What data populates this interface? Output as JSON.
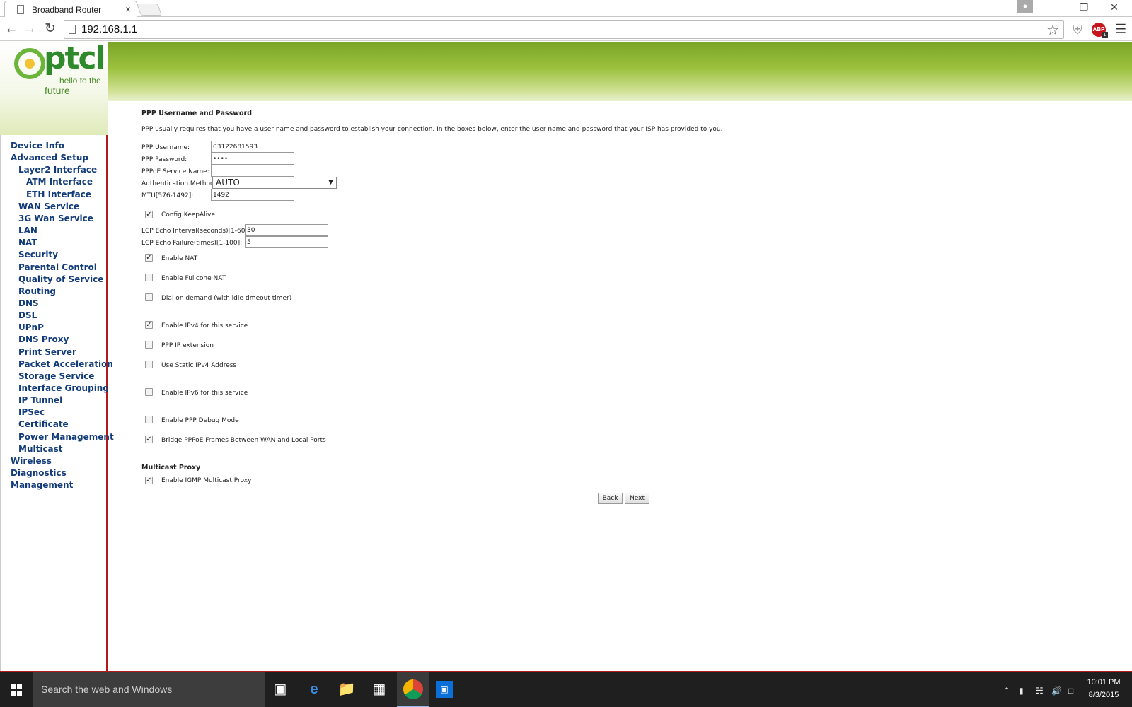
{
  "browser": {
    "tab_title": "Broadband Router",
    "tab_close": "×",
    "url": "192.168.1.1",
    "abp_label": "ABP",
    "abp_badge": "1"
  },
  "logo": {
    "brand": "ptcl",
    "tagline_1": "hello to the",
    "tagline_2": "future",
    "colors": {
      "ring": "#6bb53a",
      "dot": "#f1c232",
      "text": "#2f8a2b"
    }
  },
  "sidebar": {
    "items": [
      {
        "label": "Device Info",
        "level": 0
      },
      {
        "label": "Advanced Setup",
        "level": 0
      },
      {
        "label": "Layer2 Interface",
        "level": 1
      },
      {
        "label": "ATM Interface",
        "level": 2
      },
      {
        "label": "ETH Interface",
        "level": 2
      },
      {
        "label": "WAN Service",
        "level": 1
      },
      {
        "label": "3G Wan Service",
        "level": 1
      },
      {
        "label": "LAN",
        "level": 1
      },
      {
        "label": "NAT",
        "level": 1
      },
      {
        "label": "Security",
        "level": 1
      },
      {
        "label": "Parental Control",
        "level": 1
      },
      {
        "label": "Quality of Service",
        "level": 1
      },
      {
        "label": "Routing",
        "level": 1
      },
      {
        "label": "DNS",
        "level": 1
      },
      {
        "label": "DSL",
        "level": 1
      },
      {
        "label": "UPnP",
        "level": 1
      },
      {
        "label": "DNS Proxy",
        "level": 1
      },
      {
        "label": "Print Server",
        "level": 1
      },
      {
        "label": "Packet Acceleration",
        "level": 1
      },
      {
        "label": "Storage Service",
        "level": 1
      },
      {
        "label": "Interface Grouping",
        "level": 1
      },
      {
        "label": "IP Tunnel",
        "level": 1
      },
      {
        "label": "IPSec",
        "level": 1
      },
      {
        "label": "Certificate",
        "level": 1
      },
      {
        "label": "Power Management",
        "level": 1
      },
      {
        "label": "Multicast",
        "level": 1
      },
      {
        "label": "Wireless",
        "level": 0
      },
      {
        "label": "Diagnostics",
        "level": 0
      },
      {
        "label": "Management",
        "level": 0
      }
    ]
  },
  "form": {
    "heading": "PPP Username and Password",
    "intro": "PPP usually requires that you have a user name and password to establish your connection. In the boxes below, enter the user name and password that your ISP has provided to you.",
    "ppp_username_label": "PPP Username:",
    "ppp_username_value": "03122681593",
    "ppp_password_label": "PPP Password:",
    "ppp_password_value": "••••",
    "pppoe_service_label": "PPPoE Service Name:",
    "pppoe_service_value": "",
    "auth_method_label": "Authentication Method:",
    "auth_method_value": "AUTO",
    "mtu_label": "MTU[576-1492]:",
    "mtu_value": "1492",
    "keepalive_label": "Config KeepAlive",
    "keepalive_checked": true,
    "lcp_interval_label": "LCP Echo Interval(seconds)[1-60]:",
    "lcp_interval_value": "30",
    "lcp_failure_label": "LCP Echo Failure(times)[1-100]:",
    "lcp_failure_value": "5",
    "options": [
      {
        "label": "Enable NAT",
        "checked": true
      },
      {
        "label": "Enable Fullcone NAT",
        "checked": false
      },
      {
        "label": "Dial on demand (with idle timeout timer)",
        "checked": false
      },
      {
        "label": "Enable IPv4 for this service",
        "checked": true
      },
      {
        "label": "PPP IP extension",
        "checked": false
      },
      {
        "label": "Use Static IPv4 Address",
        "checked": false
      },
      {
        "label": "Enable IPv6 for this service",
        "checked": false
      },
      {
        "label": "Enable PPP Debug Mode",
        "checked": false
      },
      {
        "label": "Bridge PPPoE Frames Between WAN and Local Ports",
        "checked": true
      }
    ],
    "multicast_heading": "Multicast Proxy",
    "igmp_label": "Enable IGMP Multicast Proxy",
    "igmp_checked": true,
    "back_label": "Back",
    "next_label": "Next"
  },
  "taskbar": {
    "search_placeholder": "Search the web and Windows",
    "time": "10:01 PM",
    "date": "8/3/2015"
  },
  "colors": {
    "menu_text": "#123b7a",
    "sidebar_border": "#b31b1b",
    "banner_green": "#9cc13d"
  }
}
